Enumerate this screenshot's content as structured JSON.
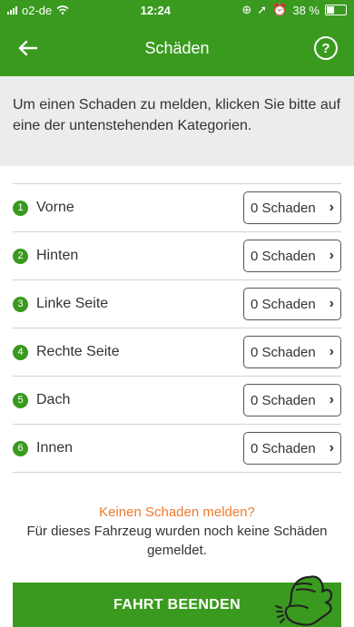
{
  "status_bar": {
    "carrier": "o2-de",
    "time": "12:24",
    "battery": "38 %"
  },
  "header": {
    "title": "Schäden"
  },
  "intro": "Um einen Schaden zu melden, klicken Sie bitte auf eine der untenstehenden Kategorien.",
  "categories": [
    {
      "number": "1",
      "label": "Vorne",
      "damage": "0 Schaden"
    },
    {
      "number": "2",
      "label": "Hinten",
      "damage": "0 Schaden"
    },
    {
      "number": "3",
      "label": "Linke Seite",
      "damage": "0 Schaden"
    },
    {
      "number": "4",
      "label": "Rechte Seite",
      "damage": "0 Schaden"
    },
    {
      "number": "5",
      "label": "Dach",
      "damage": "0 Schaden"
    },
    {
      "number": "6",
      "label": "Innen",
      "damage": "0 Schaden"
    }
  ],
  "footer": {
    "no_damage_link": "Keinen Schaden melden?",
    "note": "Für dieses Fahrzeug wurden noch keine Schäden gemeldet."
  },
  "end_button": "FAHRT BEENDEN",
  "colors": {
    "primary": "#3a9a1f",
    "accent": "#ee7a2c"
  },
  "icons": [
    "back-arrow-icon",
    "help-icon",
    "chevron-right-icon",
    "pointing-hand-icon"
  ]
}
